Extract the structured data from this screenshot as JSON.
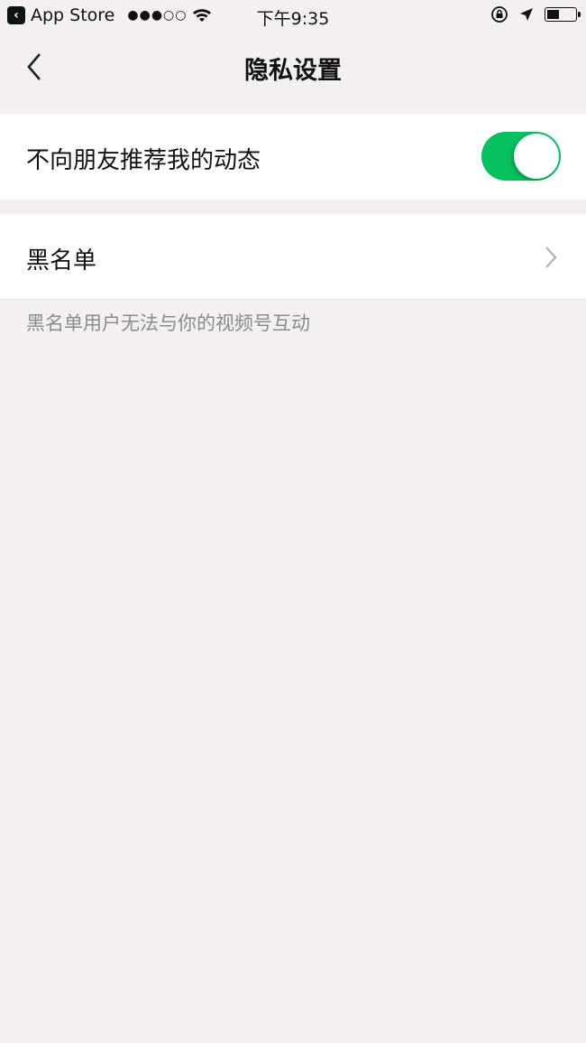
{
  "status_bar": {
    "back_app_label": "App Store",
    "signal": "●●●○○",
    "time": "下午9:35",
    "battery_level": 0.45,
    "icons": [
      "back-app-icon",
      "signal-dots-icon",
      "wifi-icon",
      "rotation-lock-icon",
      "location-arrow-icon",
      "battery-icon"
    ]
  },
  "nav": {
    "title": "隐私设置",
    "back_icon": "chevron-left-icon"
  },
  "settings": {
    "hide_from_friends": {
      "label": "不向朋友推荐我的动态",
      "on": true
    },
    "blacklist": {
      "label": "黑名单",
      "icon": "chevron-right-icon"
    },
    "blacklist_note": "黑名单用户无法与你的视频号互动"
  },
  "colors": {
    "accent": "#07c160",
    "background": "#f4eff3",
    "note_text": "#8a8a8a"
  }
}
